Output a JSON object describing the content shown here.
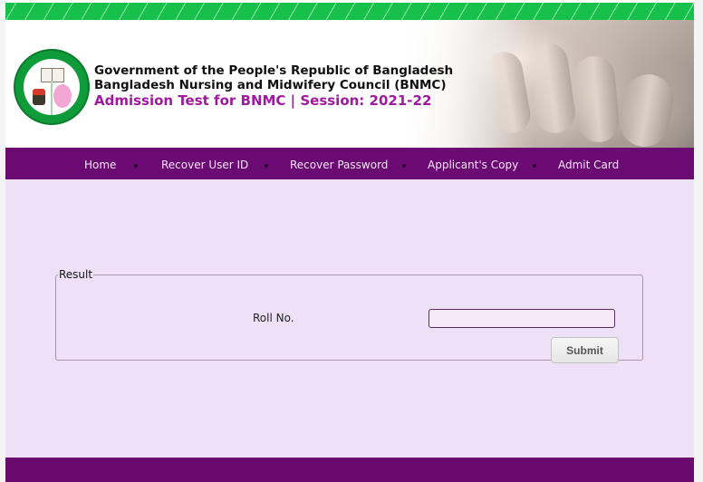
{
  "header": {
    "logo": "bnmc-logo-icon",
    "title_line1": "Government of the People's Republic of Bangladesh",
    "title_line2": "Bangladesh Nursing and Midwifery Council (BNMC)",
    "title_line3": "Admission Test for BNMC | Session: 2021-22",
    "hero_image": "baby-hand-holding-adult-finger-photo"
  },
  "nav": {
    "items": [
      {
        "label": "Home"
      },
      {
        "label": "Recover User ID"
      },
      {
        "label": "Recover Password"
      },
      {
        "label": "Applicant's Copy"
      },
      {
        "label": "Admit Card"
      }
    ],
    "separator_icon": "bullet-dot-icon"
  },
  "form": {
    "legend": "Result",
    "roll_label": "Roll No.",
    "roll_value": "",
    "roll_placeholder": "",
    "submit_label": "Submit"
  },
  "colors": {
    "stripe_green": "#17c04a",
    "nav_purple": "#6b0a72",
    "title_magenta": "#a01aa0",
    "content_lavender": "#eee0f7",
    "footer_purple": "#6b0a6e"
  }
}
